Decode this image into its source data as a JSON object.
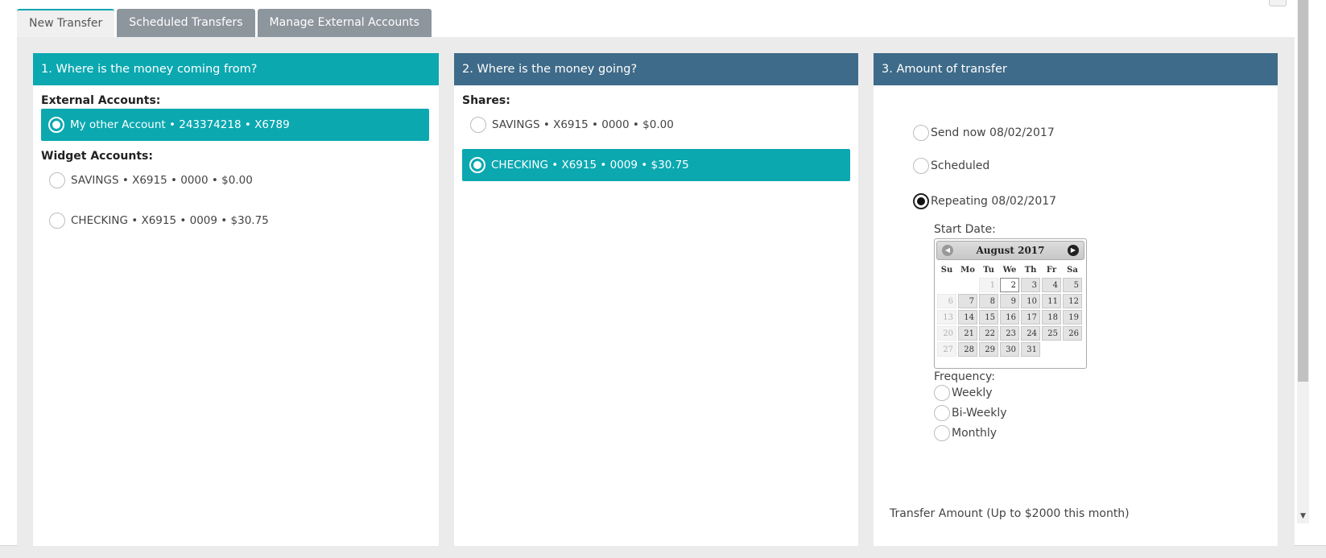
{
  "tabs": [
    {
      "label": "New Transfer",
      "active": true
    },
    {
      "label": "Scheduled Transfers",
      "active": false
    },
    {
      "label": "Manage External Accounts",
      "active": false
    }
  ],
  "from_panel": {
    "title": "1. Where is the money coming from?",
    "external_label": "External Accounts:",
    "external_accounts": [
      {
        "label": "My other Account • 243374218 • X6789",
        "selected": true
      }
    ],
    "widget_label": "Widget Accounts:",
    "widget_accounts": [
      {
        "label": "SAVINGS • X6915 • 0000 • $0.00",
        "selected": false
      },
      {
        "label": "CHECKING • X6915 • 0009 • $30.75",
        "selected": false
      }
    ]
  },
  "to_panel": {
    "title": "2. Where is the money going?",
    "shares_label": "Shares:",
    "shares": [
      {
        "label": "SAVINGS • X6915 • 0000 • $0.00",
        "selected": false
      },
      {
        "label": "CHECKING • X6915 • 0009 • $30.75",
        "selected": true
      }
    ]
  },
  "amount_panel": {
    "title": "3. Amount of transfer",
    "timing_options": [
      {
        "label": "Send now 08/02/2017",
        "selected": false
      },
      {
        "label": "Scheduled",
        "selected": false
      },
      {
        "label": "Repeating 08/02/2017",
        "selected": true
      }
    ],
    "start_date_label": "Start Date:",
    "calendar": {
      "month_label": "August 2017",
      "weekdays": [
        "Su",
        "Mo",
        "Tu",
        "We",
        "Th",
        "Fr",
        "Sa"
      ],
      "days": [
        "",
        "",
        "1",
        "2",
        "3",
        "4",
        "5",
        "6",
        "7",
        "8",
        "9",
        "10",
        "11",
        "12",
        "13",
        "14",
        "15",
        "16",
        "17",
        "18",
        "19",
        "20",
        "21",
        "22",
        "23",
        "24",
        "25",
        "26",
        "27",
        "28",
        "29",
        "30",
        "31"
      ],
      "disabled_days": [
        "1",
        "6",
        "13",
        "20",
        "27"
      ],
      "today": "2"
    },
    "frequency_label": "Frequency:",
    "frequency_options": [
      {
        "label": "Weekly",
        "selected": false
      },
      {
        "label": "Bi-Weekly",
        "selected": false
      },
      {
        "label": "Monthly",
        "selected": false
      }
    ],
    "transfer_amount_label": "Transfer Amount (Up to $2000 this month)"
  },
  "colors": {
    "teal": "#0ba8b0",
    "slate": "#3e6b89",
    "tab_inactive": "#8d959d"
  }
}
